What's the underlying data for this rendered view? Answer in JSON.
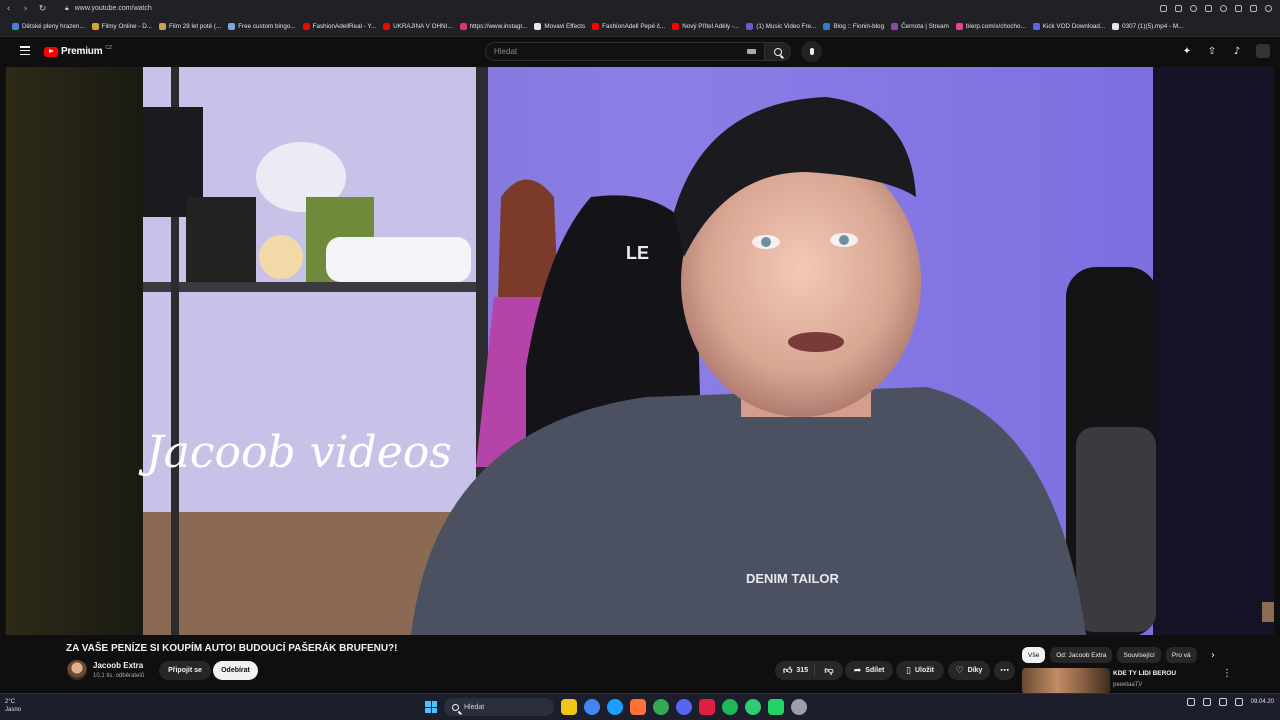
{
  "browser": {
    "url": "www.youtube.com/watch",
    "bookmarks": [
      {
        "label": "Dětské pleny hrazen...",
        "color": "#4a7fd4"
      },
      {
        "label": "Filmy Online - D...",
        "color": "#d4a33b"
      },
      {
        "label": "Film 28 let poté (...",
        "color": "#c9a24a"
      },
      {
        "label": "Free custom bingo...",
        "color": "#7aa6d8"
      },
      {
        "label": "FashionAdellReal - Y...",
        "color": "#ff0000"
      },
      {
        "label": "UKRAJINA V OHNI...",
        "color": "#ff0000"
      },
      {
        "label": "https://www.instagr...",
        "color": "#e1306c"
      },
      {
        "label": "Movavi Effects",
        "color": "#e6e6e6"
      },
      {
        "label": "FashionAdell Pepé č...",
        "color": "#ff0000"
      },
      {
        "label": "Nový Přítel Adély -...",
        "color": "#ff0000"
      },
      {
        "label": "(1) Music Video Fre...",
        "color": "#6a5acd"
      },
      {
        "label": "Blog :: Fionin-blog",
        "color": "#2e7bd6"
      },
      {
        "label": "Černota | Stream",
        "color": "#8e44ad"
      },
      {
        "label": "blerp.com/x/chocho...",
        "color": "#e84393"
      },
      {
        "label": "Kick VOD Download...",
        "color": "#5865f2"
      },
      {
        "label": "0307 (1)(5).mp4 - M...",
        "color": "#e6e6e6"
      }
    ]
  },
  "youtube": {
    "logo_text": "Premium",
    "logo_region": "CZ",
    "search_placeholder": "Hledat"
  },
  "video": {
    "title": "ZA VAŠE PENÍZE SI KOUPÍM AUTO! BUDOUCÍ PAŠERÁK BRUFENU?!",
    "neon_text": "Jacoob videos",
    "shirt_text": "DENIM TAILOR"
  },
  "channel": {
    "name": "Jacoob Extra",
    "subscribers": "10,1 tis. odběratelů",
    "join_label": "Připojit se",
    "subscribe_label": "Odebírat"
  },
  "actions": {
    "likes": "315",
    "share_label": "Sdílet",
    "save_label": "Uložit",
    "thanks_label": "Díky"
  },
  "chips": [
    "Vše",
    "Od: Jacoob Extra",
    "Související",
    "Pro vá"
  ],
  "recommendation": {
    "title": "KDE TY LIDI BEROU",
    "channel": "peeetaaTV"
  },
  "taskbar": {
    "weather_temp": "2°C",
    "weather_desc": "Jasno",
    "search_label": "Hledat",
    "date": "09.04.20",
    "apps": [
      "#f0c419",
      "#4285f4",
      "#1a9fff",
      "#ff7139",
      "#34a853",
      "#5865f2",
      "#e02040",
      "#1db954",
      "#2ecc71",
      "#25d366",
      "#9aa0a6"
    ]
  }
}
